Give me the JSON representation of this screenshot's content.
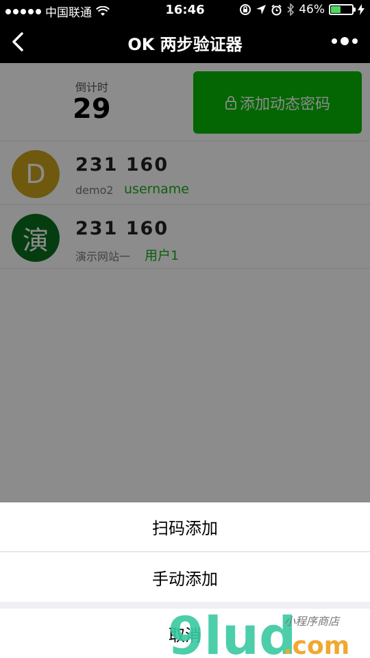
{
  "statusbar": {
    "carrier": "中国联通",
    "time": "16:46",
    "battery_percent": "46%",
    "battery_level": 0.46
  },
  "navbar": {
    "title": "OK 两步验证器"
  },
  "counter": {
    "label": "倒计时",
    "value": "29"
  },
  "add_button": {
    "label": "添加动态密码"
  },
  "accounts": [
    {
      "avatar": "D",
      "avatar_color": "#c9a21c",
      "code": "231 160",
      "site": "demo2",
      "user": "username"
    },
    {
      "avatar": "演",
      "avatar_color": "#0a6f1f",
      "code": "231 160",
      "site": "演示网站一",
      "user": "用户1"
    }
  ],
  "sheet": {
    "scan_add": "扫码添加",
    "manual_add": "手动添加",
    "cancel": "取消"
  },
  "watermark": {
    "brand": "9lud",
    "suffix": ".com",
    "tagline": "小程序商店"
  },
  "colors": {
    "accent": "#09bb07",
    "user_text": "#1aad19"
  }
}
